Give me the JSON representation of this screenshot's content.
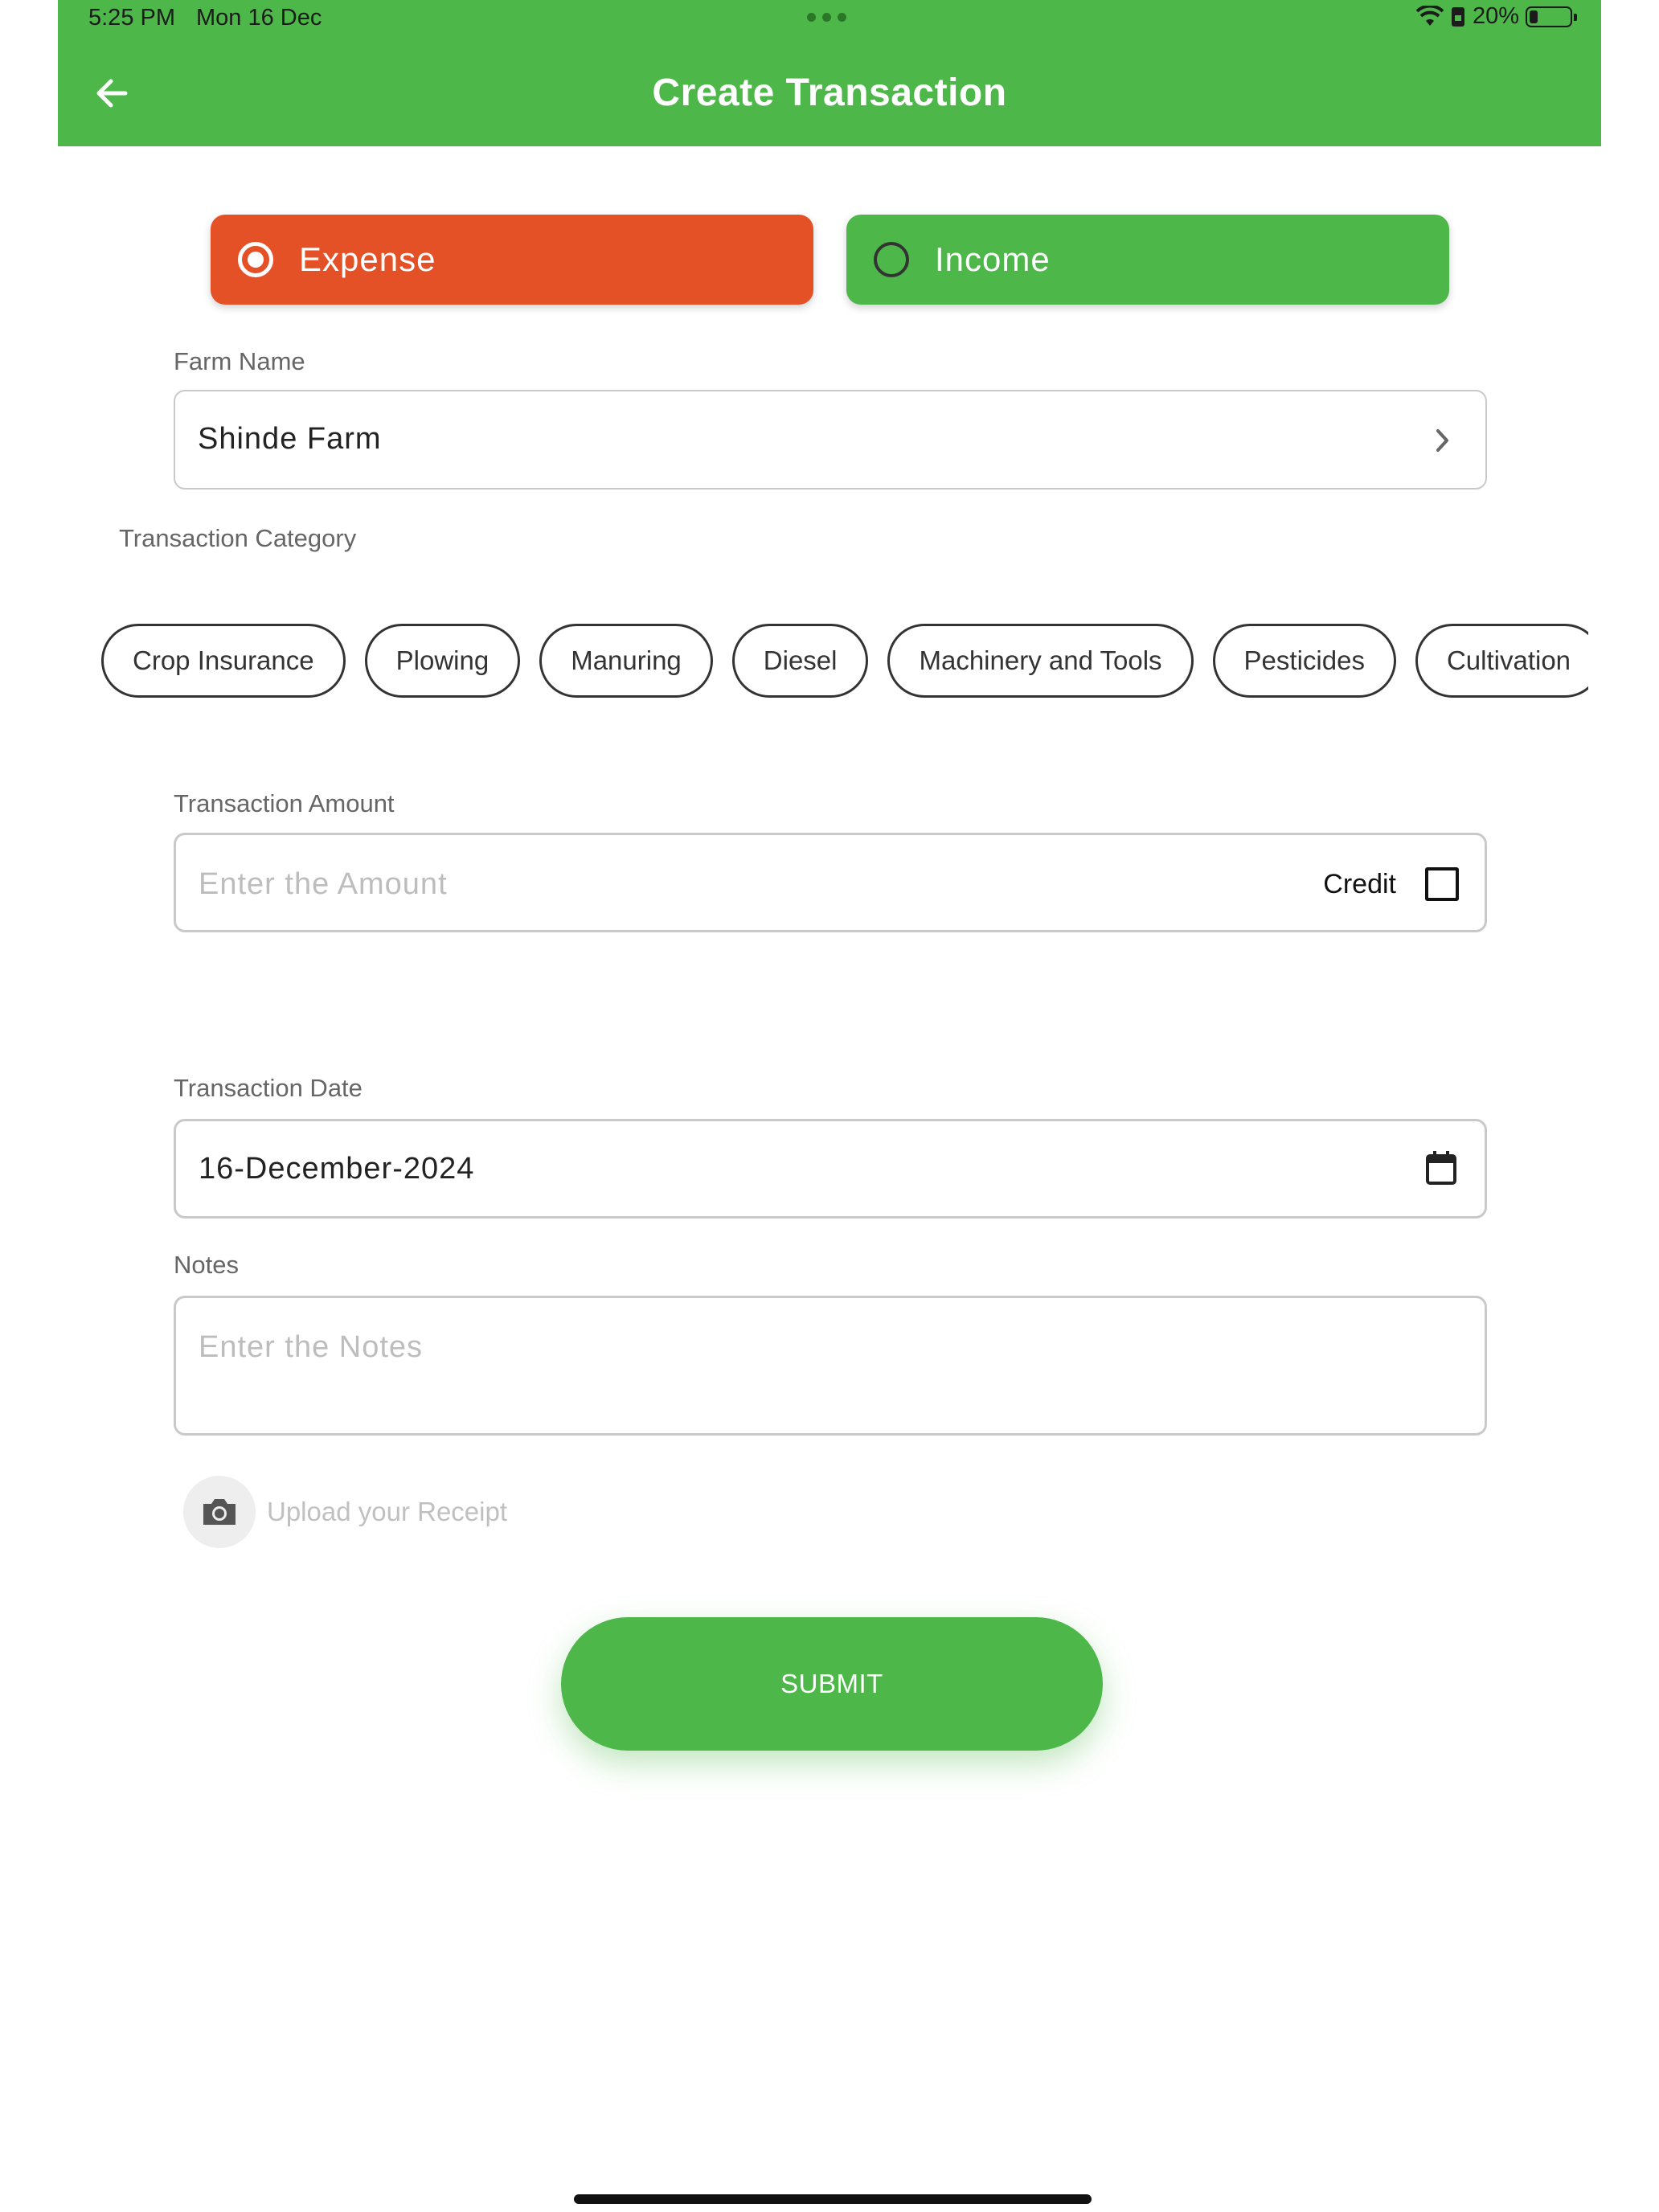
{
  "status_bar": {
    "time": "5:25 PM",
    "date": "Mon 16 Dec",
    "battery": "20%",
    "battery_level": 0.2
  },
  "header": {
    "title": "Create Transaction"
  },
  "transaction_type": {
    "expense_label": "Expense",
    "income_label": "Income",
    "selected": "Expense"
  },
  "farm": {
    "label": "Farm Name",
    "value": "Shinde Farm"
  },
  "category": {
    "label": "Transaction Category",
    "chips": [
      "Crop Insurance",
      "Plowing",
      "Manuring",
      "Diesel",
      "Machinery and Tools",
      "Pesticides",
      "Cultivation"
    ]
  },
  "amount": {
    "label": "Transaction Amount",
    "placeholder": "Enter the Amount",
    "credit_label": "Credit",
    "credit_checked": false
  },
  "date": {
    "label": "Transaction Date",
    "value": "16-December-2024"
  },
  "notes": {
    "label": "Notes",
    "placeholder": "Enter the Notes"
  },
  "upload": {
    "label": "Upload your Receipt"
  },
  "submit": {
    "label": "SUBMIT"
  },
  "colors": {
    "brand_green": "#4db849",
    "expense_orange": "#e55127"
  }
}
